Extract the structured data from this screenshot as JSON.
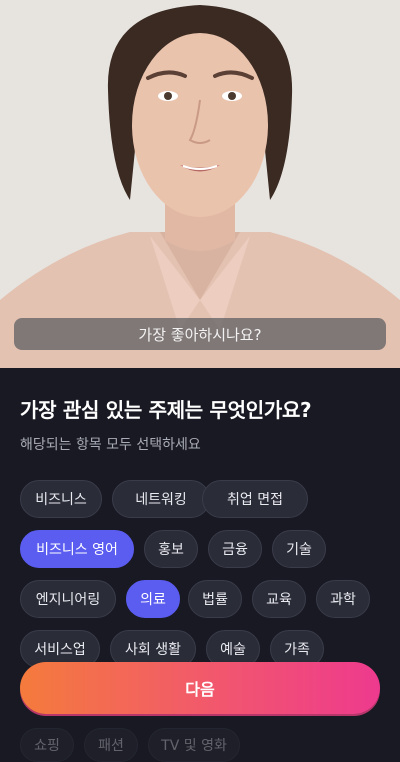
{
  "video": {
    "caption": "가장 좋아하시나요?"
  },
  "question": {
    "title": "가장 관심 있는 주제는 무엇인가요?",
    "subtitle": "해당되는 항목 모두 선택하세요"
  },
  "topics": [
    {
      "label": "비즈니스",
      "selected": false
    },
    {
      "label": "네트워킹",
      "selected": false
    },
    {
      "label": "취업 면접",
      "selected": false
    },
    {
      "label": "비즈니스 영어",
      "selected": true
    },
    {
      "label": "홍보",
      "selected": false
    },
    {
      "label": "금융",
      "selected": false
    },
    {
      "label": "기술",
      "selected": false
    },
    {
      "label": "엔지니어링",
      "selected": false
    },
    {
      "label": "의료",
      "selected": true
    },
    {
      "label": "법률",
      "selected": false
    },
    {
      "label": "교육",
      "selected": false
    },
    {
      "label": "과학",
      "selected": false
    },
    {
      "label": "서비스업",
      "selected": false
    },
    {
      "label": "사회 생활",
      "selected": false
    },
    {
      "label": "예술",
      "selected": false
    },
    {
      "label": "가족",
      "selected": false
    },
    {
      "label": "쇼핑",
      "selected": false
    },
    {
      "label": "패션",
      "selected": false
    },
    {
      "label": "TV 및 영화",
      "selected": false
    }
  ],
  "next_button": {
    "label": "다음"
  },
  "colors": {
    "background": "#181922",
    "chip": "#2a2c38",
    "chip_selected": "#5b5cf0",
    "button_start": "#f47b3c",
    "button_end": "#ee3a8e"
  }
}
